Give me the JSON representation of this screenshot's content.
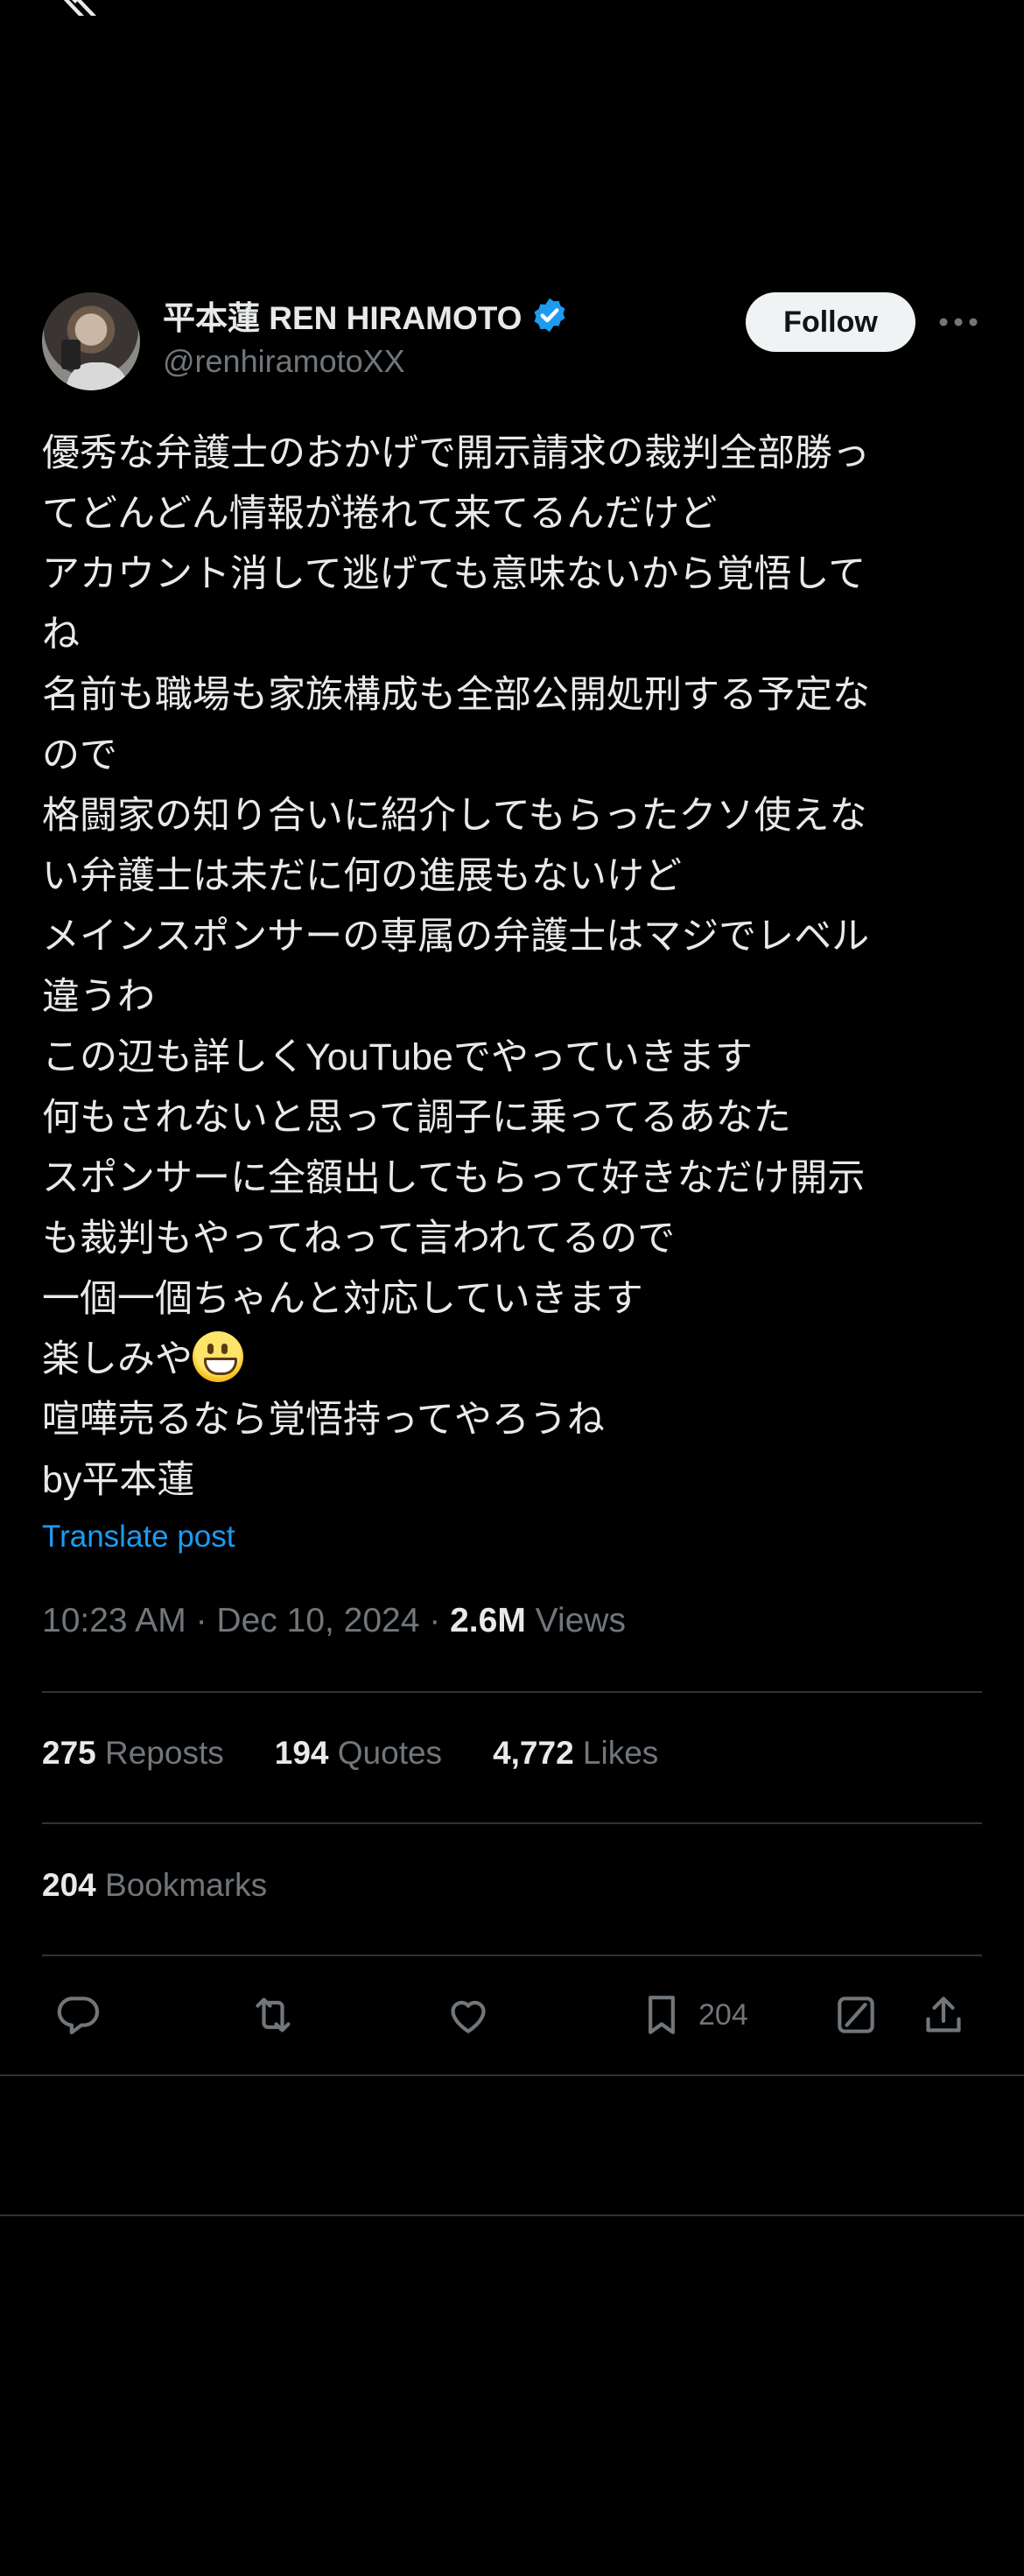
{
  "app": {
    "logo": "x-logo"
  },
  "author": {
    "display_name": "平本蓮 REN HIRAMOTO",
    "handle": "@renhiramotoXX",
    "verified": true
  },
  "header": {
    "follow_label": "Follow",
    "more_icon": "more-horizontal-icon"
  },
  "post": {
    "lines": [
      "優秀な弁護士のおかげで開示請求の裁判全部勝っ",
      "てどんどん情報が捲れて来てるんだけど",
      "アカウント消して逃げても意味ないから覚悟して",
      "ね",
      "名前も職場も家族構成も全部公開処刑する予定な",
      "ので",
      "格闘家の知り合いに紹介してもらったクソ使えな",
      "い弁護士は未だに何の進展もないけど",
      "メインスポンサーの専属の弁護士はマジでレベル",
      "違うわ",
      "この辺も詳しくYouTubeでやっていきます",
      "何もされないと思って調子に乗ってるあなた",
      "スポンサーに全額出してもらって好きなだけ開示",
      "も裁判もやってねって言われてるので",
      "一個一個ちゃんと対応していきます",
      "楽しみや",
      "喧嘩売るなら覚悟持ってやろうね",
      "by平本蓮"
    ],
    "emoji": "grinning-face-emoji",
    "translate_label": "Translate post",
    "time": "10:23 AM · Dec 10, 2024 · ",
    "views_count": "2.6M",
    "views_label": " Views"
  },
  "stats": {
    "reposts_count": "275",
    "reposts_label": " Reposts",
    "quotes_count": "194",
    "quotes_label": " Quotes",
    "likes_count": "4,772",
    "likes_label": " Likes",
    "bookmarks_count": "204",
    "bookmarks_label": " Bookmarks"
  },
  "actions": {
    "reply_icon": "reply-icon",
    "repost_icon": "repost-icon",
    "like_icon": "like-icon",
    "bookmark_icon": "bookmark-icon",
    "bookmark_count": "204",
    "grok_icon": "grok-icon",
    "share_icon": "share-icon"
  },
  "colors": {
    "background": "#000000",
    "text": "#e7e9ea",
    "muted": "#71767b",
    "accent": "#1d9bf0",
    "divider": "#2f3336",
    "follow_bg": "#eff3f4"
  }
}
